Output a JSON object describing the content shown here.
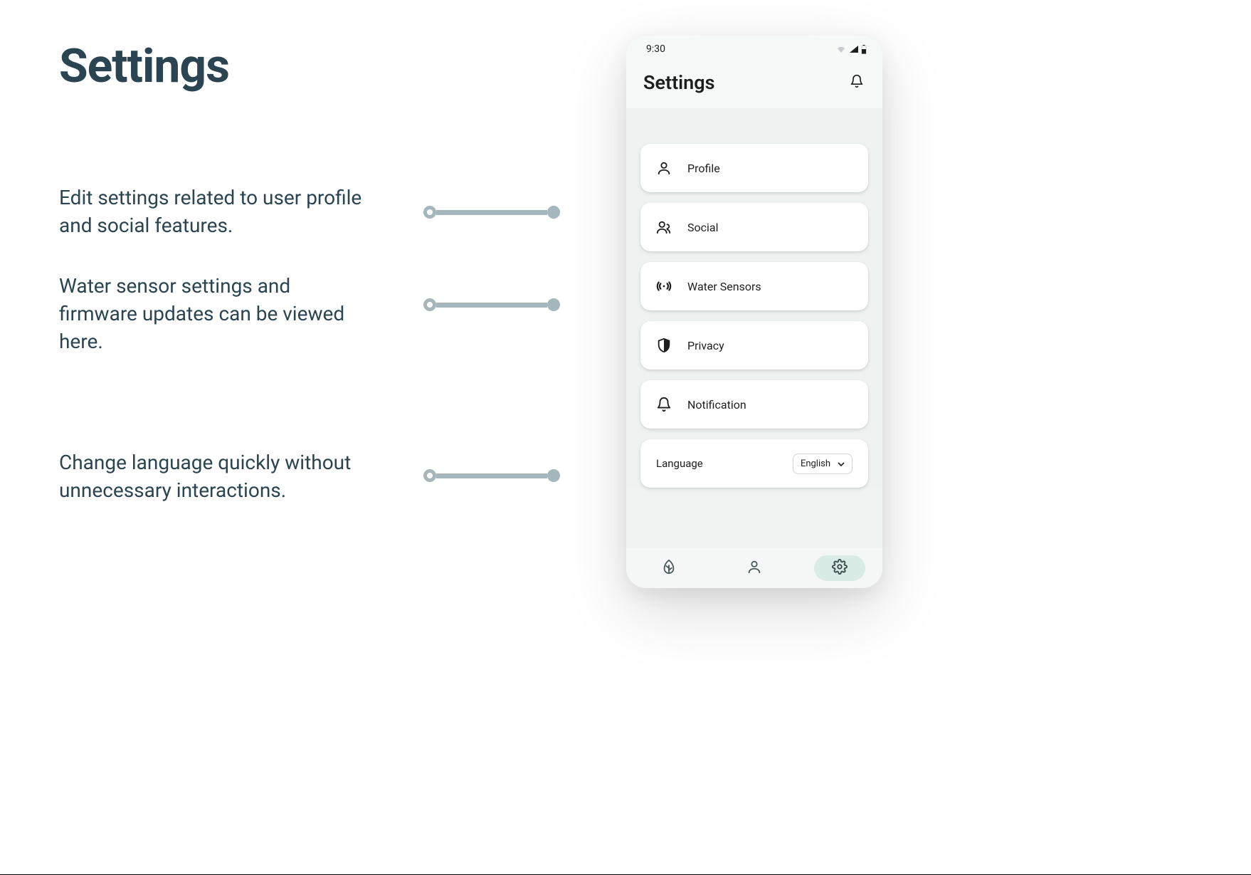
{
  "page_title": "Settings",
  "descriptions": {
    "d1": "Edit settings related to user profile and social features.",
    "d2": "Water sensor settings and firmware updates can be viewed here.",
    "d3": "Change language quickly without unnecessary interactions."
  },
  "phone": {
    "status_time": "9:30",
    "header_title": "Settings",
    "items": {
      "profile": "Profile",
      "social": "Social",
      "sensors": "Water Sensors",
      "privacy": "Privacy",
      "notification": "Notification",
      "language_label": "Language",
      "language_value": "English"
    }
  }
}
